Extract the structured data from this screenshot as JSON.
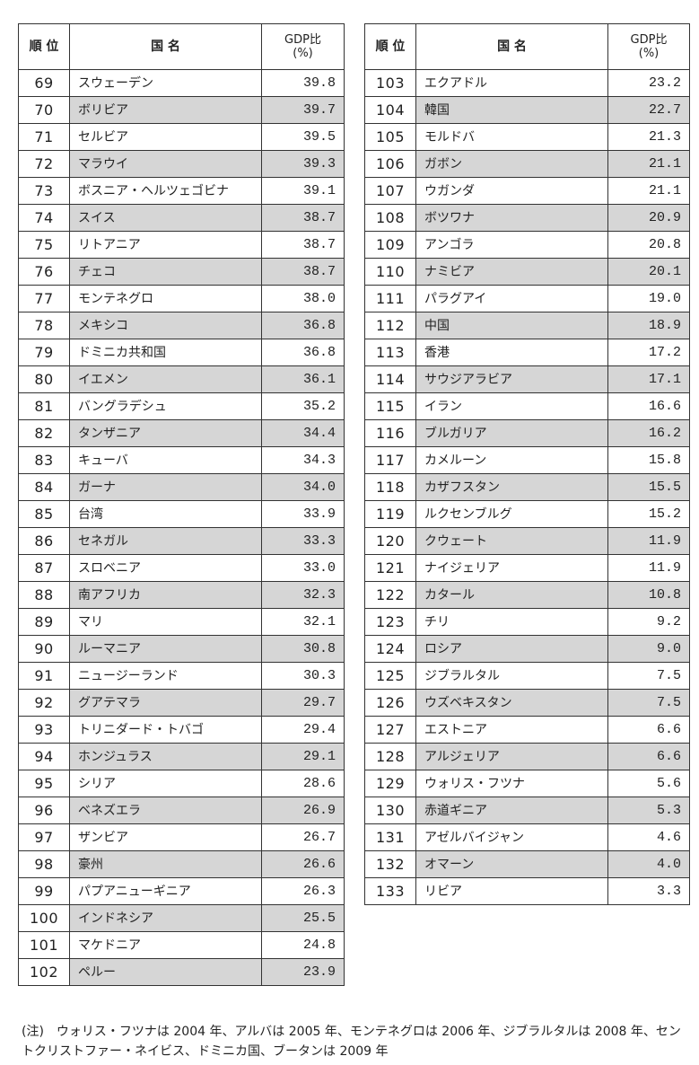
{
  "headers": {
    "rank": "順 位",
    "country": "国 名",
    "gdp": "GDP比",
    "gdp_unit": "(%)"
  },
  "left_rows": [
    {
      "rank": "69",
      "country": "スウェーデン",
      "value": "39.8"
    },
    {
      "rank": "70",
      "country": "ボリビア",
      "value": "39.7"
    },
    {
      "rank": "71",
      "country": "セルビア",
      "value": "39.5"
    },
    {
      "rank": "72",
      "country": "マラウイ",
      "value": "39.3"
    },
    {
      "rank": "73",
      "country": "ボスニア・ヘルツェゴビナ",
      "value": "39.1"
    },
    {
      "rank": "74",
      "country": "スイス",
      "value": "38.7"
    },
    {
      "rank": "75",
      "country": "リトアニア",
      "value": "38.7"
    },
    {
      "rank": "76",
      "country": "チェコ",
      "value": "38.7"
    },
    {
      "rank": "77",
      "country": "モンテネグロ",
      "value": "38.0"
    },
    {
      "rank": "78",
      "country": "メキシコ",
      "value": "36.8"
    },
    {
      "rank": "79",
      "country": "ドミニカ共和国",
      "value": "36.8"
    },
    {
      "rank": "80",
      "country": "イエメン",
      "value": "36.1"
    },
    {
      "rank": "81",
      "country": "バングラデシュ",
      "value": "35.2"
    },
    {
      "rank": "82",
      "country": "タンザニア",
      "value": "34.4"
    },
    {
      "rank": "83",
      "country": "キューバ",
      "value": "34.3"
    },
    {
      "rank": "84",
      "country": "ガーナ",
      "value": "34.0"
    },
    {
      "rank": "85",
      "country": "台湾",
      "value": "33.9"
    },
    {
      "rank": "86",
      "country": "セネガル",
      "value": "33.3"
    },
    {
      "rank": "87",
      "country": "スロベニア",
      "value": "33.0"
    },
    {
      "rank": "88",
      "country": "南アフリカ",
      "value": "32.3"
    },
    {
      "rank": "89",
      "country": "マリ",
      "value": "32.1"
    },
    {
      "rank": "90",
      "country": "ルーマニア",
      "value": "30.8"
    },
    {
      "rank": "91",
      "country": "ニュージーランド",
      "value": "30.3"
    },
    {
      "rank": "92",
      "country": "グアテマラ",
      "value": "29.7"
    },
    {
      "rank": "93",
      "country": "トリニダード・トバゴ",
      "value": "29.4"
    },
    {
      "rank": "94",
      "country": "ホンジュラス",
      "value": "29.1"
    },
    {
      "rank": "95",
      "country": "シリア",
      "value": "28.6"
    },
    {
      "rank": "96",
      "country": "ベネズエラ",
      "value": "26.9"
    },
    {
      "rank": "97",
      "country": "ザンビア",
      "value": "26.7"
    },
    {
      "rank": "98",
      "country": "豪州",
      "value": "26.6"
    },
    {
      "rank": "99",
      "country": "パプアニューギニア",
      "value": "26.3"
    },
    {
      "rank": "100",
      "country": "インドネシア",
      "value": "25.5"
    },
    {
      "rank": "101",
      "country": "マケドニア",
      "value": "24.8"
    },
    {
      "rank": "102",
      "country": "ペルー",
      "value": "23.9"
    }
  ],
  "right_rows": [
    {
      "rank": "103",
      "country": "エクアドル",
      "value": "23.2"
    },
    {
      "rank": "104",
      "country": "韓国",
      "value": "22.7"
    },
    {
      "rank": "105",
      "country": "モルドバ",
      "value": "21.3"
    },
    {
      "rank": "106",
      "country": "ガボン",
      "value": "21.1"
    },
    {
      "rank": "107",
      "country": "ウガンダ",
      "value": "21.1"
    },
    {
      "rank": "108",
      "country": "ボツワナ",
      "value": "20.9"
    },
    {
      "rank": "109",
      "country": "アンゴラ",
      "value": "20.8"
    },
    {
      "rank": "110",
      "country": "ナミビア",
      "value": "20.1"
    },
    {
      "rank": "111",
      "country": "パラグアイ",
      "value": "19.0"
    },
    {
      "rank": "112",
      "country": "中国",
      "value": "18.9"
    },
    {
      "rank": "113",
      "country": "香港",
      "value": "17.2"
    },
    {
      "rank": "114",
      "country": "サウジアラビア",
      "value": "17.1"
    },
    {
      "rank": "115",
      "country": "イラン",
      "value": "16.6"
    },
    {
      "rank": "116",
      "country": "ブルガリア",
      "value": "16.2"
    },
    {
      "rank": "117",
      "country": "カメルーン",
      "value": "15.8"
    },
    {
      "rank": "118",
      "country": "カザフスタン",
      "value": "15.5"
    },
    {
      "rank": "119",
      "country": "ルクセンブルグ",
      "value": "15.2"
    },
    {
      "rank": "120",
      "country": "クウェート",
      "value": "11.9"
    },
    {
      "rank": "121",
      "country": "ナイジェリア",
      "value": "11.9"
    },
    {
      "rank": "122",
      "country": "カタール",
      "value": "10.8"
    },
    {
      "rank": "123",
      "country": "チリ",
      "value": "9.2"
    },
    {
      "rank": "124",
      "country": "ロシア",
      "value": "9.0"
    },
    {
      "rank": "125",
      "country": "ジブラルタル",
      "value": "7.5"
    },
    {
      "rank": "126",
      "country": "ウズベキスタン",
      "value": "7.5"
    },
    {
      "rank": "127",
      "country": "エストニア",
      "value": "6.6"
    },
    {
      "rank": "128",
      "country": "アルジェリア",
      "value": "6.6"
    },
    {
      "rank": "129",
      "country": "ウォリス・フツナ",
      "value": "5.6"
    },
    {
      "rank": "130",
      "country": "赤道ギニア",
      "value": "5.3"
    },
    {
      "rank": "131",
      "country": "アゼルバイジャン",
      "value": "4.6"
    },
    {
      "rank": "132",
      "country": "オマーン",
      "value": "4.0"
    },
    {
      "rank": "133",
      "country": "リビア",
      "value": "3.3"
    }
  ],
  "note": "(注)　ウォリス・フツナは 2004 年、アルバは 2005 年、モンテネグロは 2006 年、ジブラルタルは 2008 年、セントクリストファー・ネイビス、ドミニカ国、ブータンは 2009 年"
}
